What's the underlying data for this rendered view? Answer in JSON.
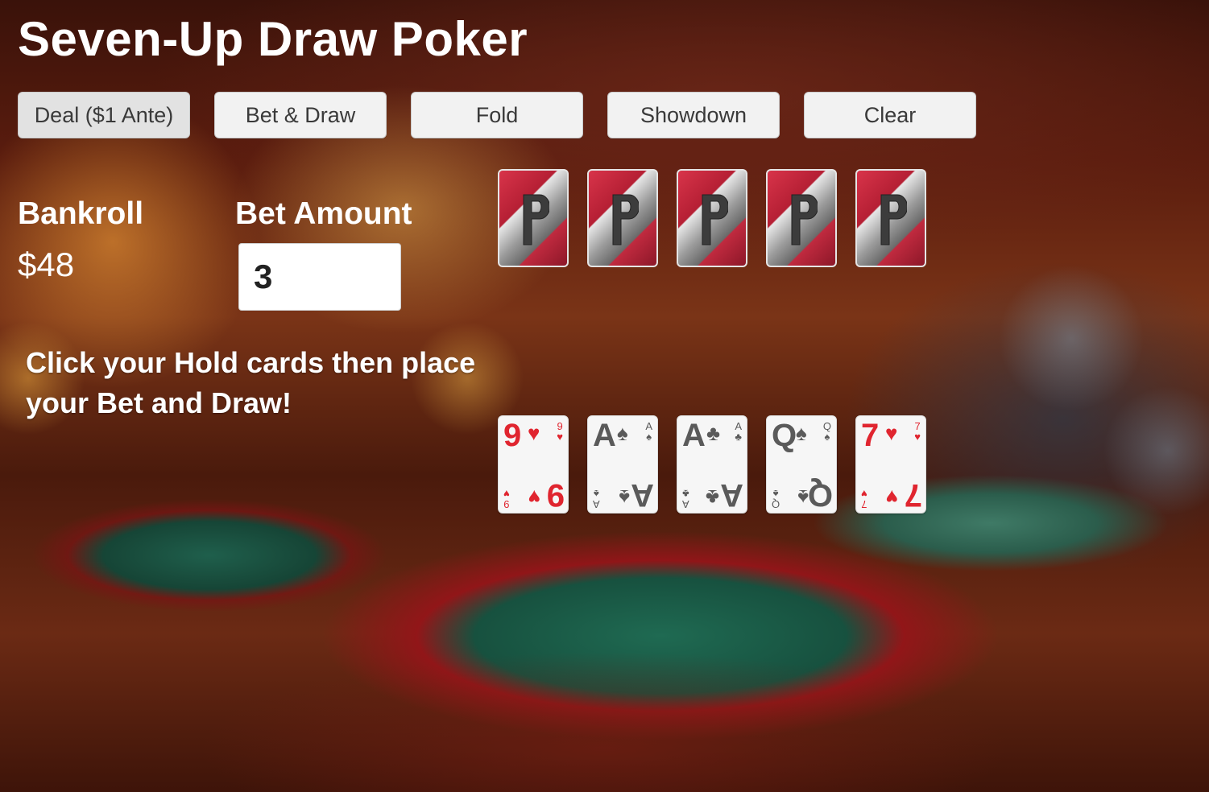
{
  "title": "Seven-Up Draw Poker",
  "buttons": {
    "deal": "Deal ($1 Ante)",
    "bet_draw": "Bet & Draw",
    "fold": "Fold",
    "showdown": "Showdown",
    "clear": "Clear"
  },
  "bankroll": {
    "label": "Bankroll",
    "value": "$48"
  },
  "bet": {
    "label": "Bet Amount",
    "value": "3"
  },
  "message": "Click your Hold cards then place your Bet and Draw!",
  "dealer_hand": {
    "count": 5,
    "face": "down"
  },
  "player_hand": [
    {
      "rank": "9",
      "suit": "♥",
      "color": "red"
    },
    {
      "rank": "A",
      "suit": "♠",
      "color": "grey"
    },
    {
      "rank": "A",
      "suit": "♣",
      "color": "grey"
    },
    {
      "rank": "Q",
      "suit": "♠",
      "color": "grey"
    },
    {
      "rank": "7",
      "suit": "♥",
      "color": "red"
    }
  ],
  "colors": {
    "card_back_red": "#c02a3f",
    "suit_red": "#e0252f",
    "suit_grey": "#5a5a5a"
  }
}
